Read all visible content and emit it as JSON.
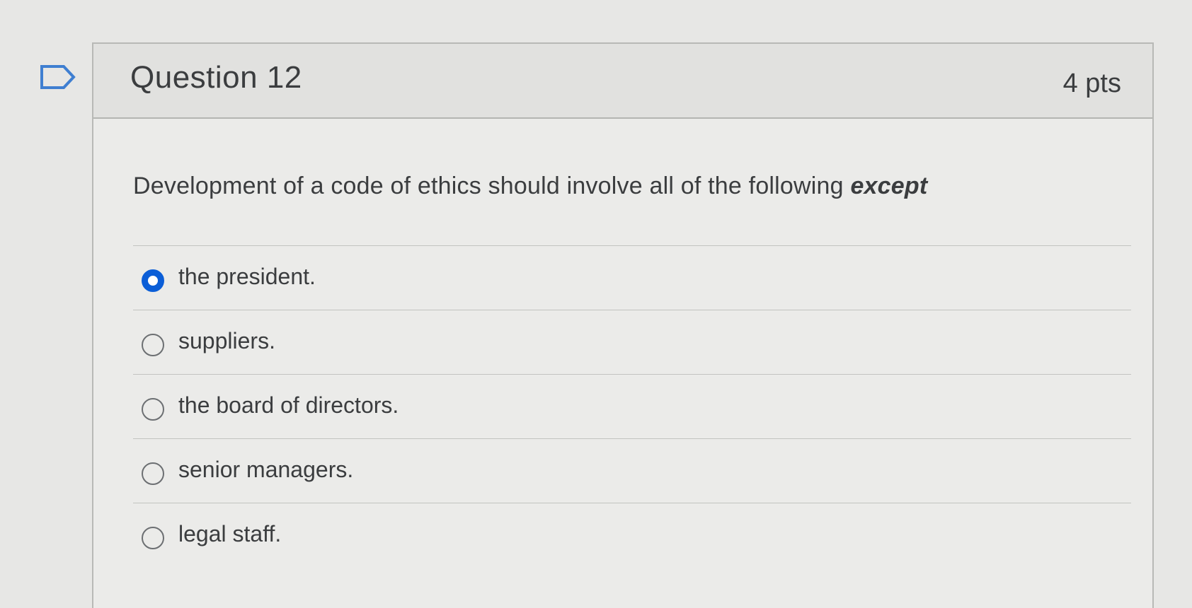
{
  "question": {
    "title": "Question 12",
    "points": "4 pts",
    "text_main": "Development of a code of ethics should involve all of the following",
    "text_emphasis": "except",
    "flag_icon": "flag-outline-icon"
  },
  "answers": [
    {
      "label": "the president.",
      "selected": true
    },
    {
      "label": "suppliers.",
      "selected": false
    },
    {
      "label": "the board of directors.",
      "selected": false
    },
    {
      "label": "senior managers.",
      "selected": false
    },
    {
      "label": "legal staff.",
      "selected": false
    }
  ],
  "colors": {
    "selected_radio": "#0b5ed7",
    "text": "#3b3d3f",
    "page_background": "#e7e7e5"
  }
}
